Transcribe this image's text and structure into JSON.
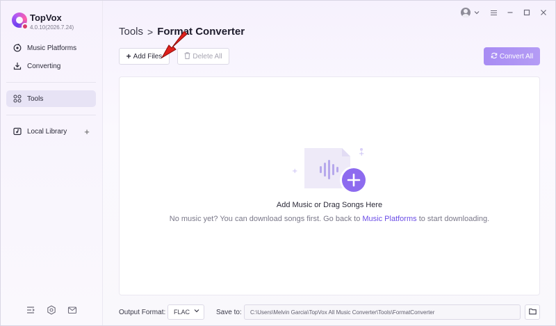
{
  "app": {
    "name": "TopVox",
    "version": "4.0.10(2026.7.24)"
  },
  "sidebar": {
    "items": [
      {
        "label": "Music Platforms",
        "icon": "music-platform-icon"
      },
      {
        "label": "Converting",
        "icon": "download-icon"
      },
      {
        "label": "Tools",
        "icon": "grid-icon",
        "active": true
      },
      {
        "label": "Local Library",
        "icon": "library-icon"
      }
    ],
    "add_icon": "plus-icon",
    "bottom_icons": [
      "menu-collapse-icon",
      "settings-icon",
      "mail-icon"
    ]
  },
  "window_controls": [
    "avatar",
    "chevron-down-icon",
    "menu-icon",
    "minimize-icon",
    "maximize-icon",
    "close-icon"
  ],
  "breadcrumb": {
    "root": "Tools",
    "separator": ">",
    "current": "Format Converter"
  },
  "toolbar": {
    "add_files": "Add Files",
    "delete_all": "Delete All",
    "convert_all": "Convert All"
  },
  "empty_state": {
    "title": "Add Music or Drag Songs Here",
    "sub_before": "No music yet? You can download songs first. Go back to ",
    "sub_link": "Music Platforms",
    "sub_after": " to start downloading."
  },
  "bottom_bar": {
    "output_format_label": "Output Format:",
    "output_format_value": "FLAC",
    "save_to_label": "Save to:",
    "save_to_path": "C:\\Users\\Melvin Garcia\\TopVox All Music Converter\\Tools\\FormatConverter"
  },
  "colors": {
    "accent": "#6b4de6",
    "convert_button": "#ad93f4",
    "arrow": "#e0211c"
  }
}
